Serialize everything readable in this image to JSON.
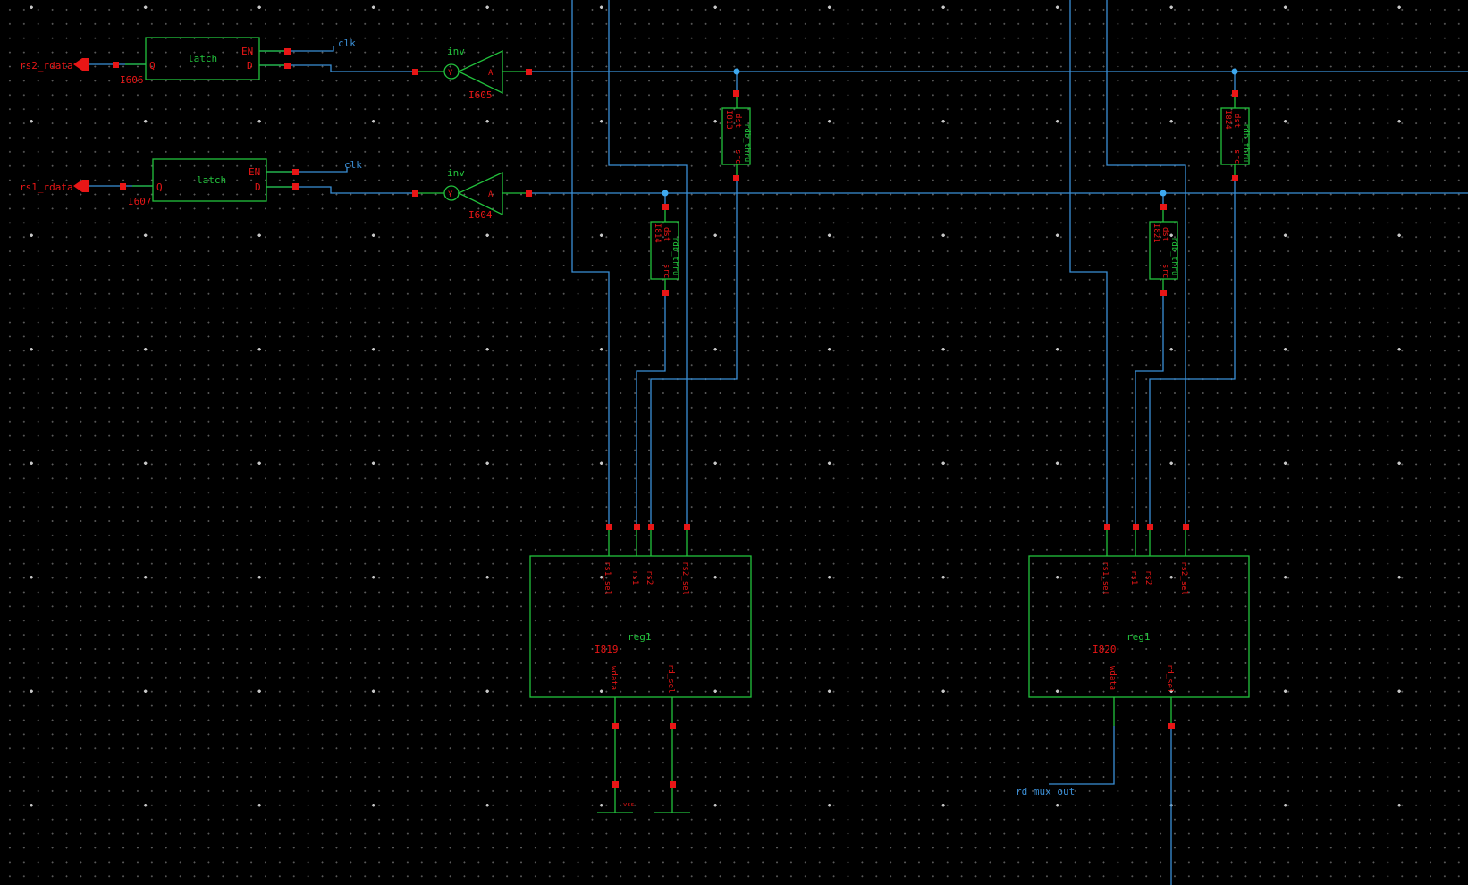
{
  "schematic": {
    "latches": [
      {
        "id": "I606",
        "cell": "latch",
        "pins": {
          "en": "EN",
          "d": "D",
          "q": "Q"
        }
      },
      {
        "id": "I607",
        "cell": "latch",
        "pins": {
          "en": "EN",
          "d": "D",
          "q": "Q"
        }
      }
    ],
    "inverters": [
      {
        "id": "I605",
        "cell": "inv",
        "pins": {
          "a": "A",
          "y": "Y"
        }
      },
      {
        "id": "I604",
        "cell": "inv",
        "pins": {
          "a": "A",
          "y": "Y"
        }
      }
    ],
    "passthrough_cells": [
      {
        "id": "I813",
        "cell": "rdb_thru",
        "pins": {
          "dst": "dst",
          "src": "src"
        }
      },
      {
        "id": "I814",
        "cell": "rdb_thru",
        "pins": {
          "dst": "dst",
          "src": "src"
        }
      },
      {
        "id": "I821",
        "cell": "rdb_thru",
        "pins": {
          "dst": "dst",
          "src": "src"
        }
      },
      {
        "id": "I824",
        "cell": "rdb_thru",
        "pins": {
          "dst": "dst",
          "src": "src"
        }
      }
    ],
    "registers": [
      {
        "id": "I819",
        "cell": "reg1",
        "pins": {
          "rs1_sel": "rs1_sel",
          "rs1": "rs1",
          "rs2": "rs2",
          "rs2_sel": "rs2_sel",
          "wdata": "wdata",
          "rd_sel": "rd_sel"
        }
      },
      {
        "id": "I820",
        "cell": "reg1",
        "pins": {
          "rs1_sel": "rs1_sel",
          "rs1": "rs1",
          "rs2": "rs2",
          "rs2_sel": "rs2_sel",
          "wdata": "wdata",
          "rd_sel": "rd_sel"
        }
      }
    ],
    "nets": {
      "rs2_rdata": "rs2_rdata",
      "rs1_rdata": "rs1_rdata",
      "clk_top": "clk",
      "clk_bottom": "clk",
      "rd_mux_out": "rd_mux_out",
      "vss": "vss"
    }
  },
  "colors": {
    "background": "#000000",
    "wire": "#3b8fd6",
    "instance": "#22c13c",
    "pin": "#e81616",
    "junction": "#3ea9f0"
  }
}
